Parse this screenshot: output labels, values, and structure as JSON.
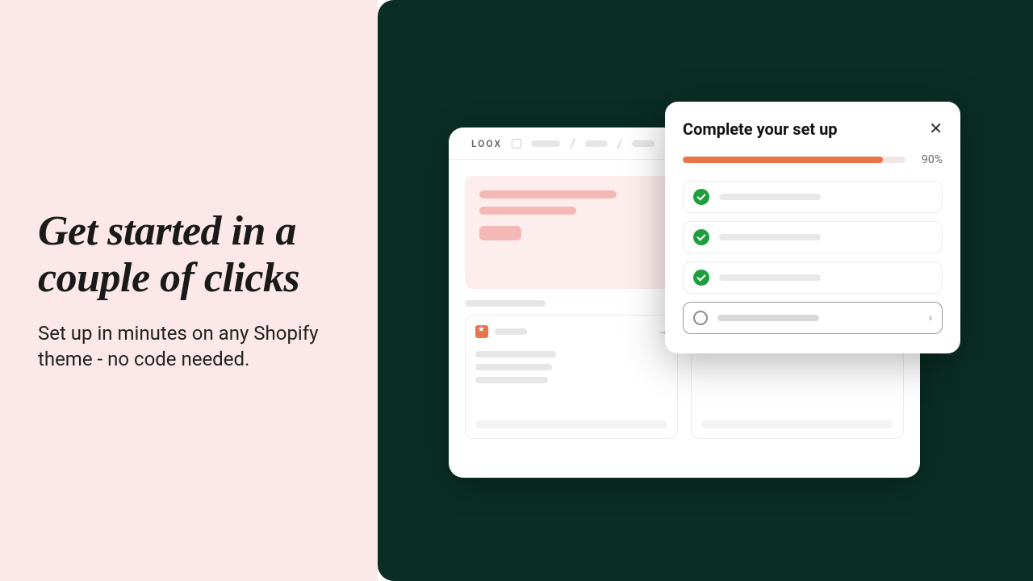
{
  "hero": {
    "heading": "Get started in a couple of clicks",
    "subheading": "Set up in minutes on any Shopify theme - no code needed."
  },
  "app": {
    "logo": "LOOX"
  },
  "setup": {
    "title": "Complete your set up",
    "progress_percent": 90,
    "progress_label": "90%",
    "tasks": [
      {
        "done": true
      },
      {
        "done": true
      },
      {
        "done": true
      },
      {
        "done": false
      }
    ]
  }
}
